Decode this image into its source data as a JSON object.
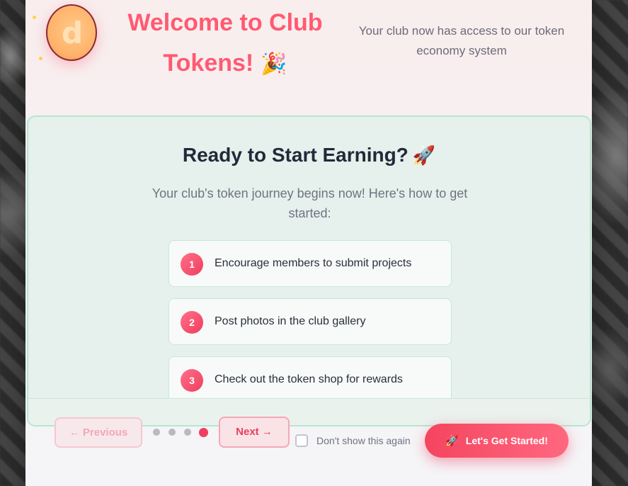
{
  "header": {
    "title": "Welcome to Club Tokens!",
    "title_emoji": "🎉",
    "subtitle": "Your club now has access to our token economy system",
    "coin_letter": "d"
  },
  "card": {
    "title": "Ready to Start Earning?",
    "title_emoji": "🚀",
    "description": "Your club's token journey begins now! Here's how to get started:",
    "steps": [
      {
        "number": "1",
        "text": "Encourage members to submit projects"
      },
      {
        "number": "2",
        "text": "Post photos in the club gallery"
      },
      {
        "number": "3",
        "text": "Check out the token shop for rewards"
      }
    ]
  },
  "footer": {
    "previous_label": "Previous",
    "previous_icon": "←",
    "next_label": "Next",
    "next_icon": "→",
    "pagination": {
      "total": 4,
      "current": 4
    },
    "dont_show_label": "Don't show this again",
    "start_label": "Let's Get Started!",
    "start_icon": "🚀"
  },
  "colors": {
    "accent": "#f03e5e",
    "title": "#ff5a72",
    "panel_border": "#b8e6d0"
  }
}
